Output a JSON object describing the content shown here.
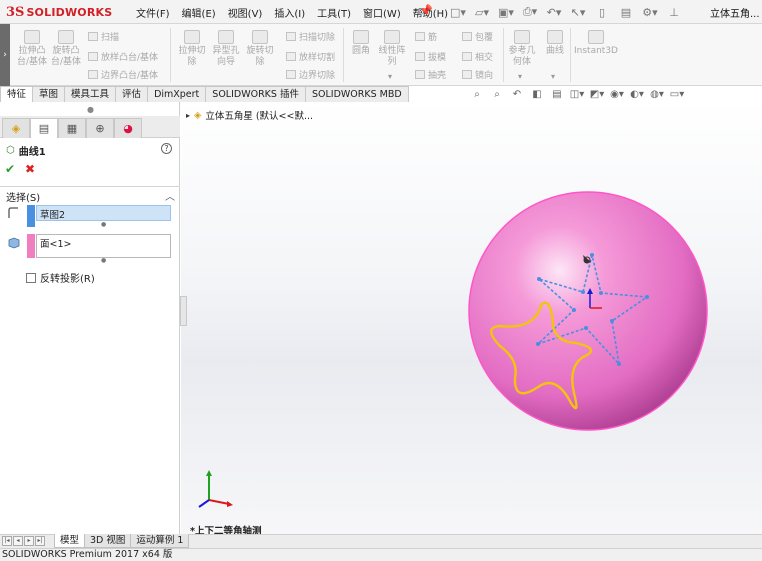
{
  "app": {
    "brand": "SOLIDWORKS",
    "document_title": "立体五角..."
  },
  "menu": [
    "文件(F)",
    "编辑(E)",
    "视图(V)",
    "插入(I)",
    "工具(T)",
    "窗口(W)",
    "帮助(H)"
  ],
  "ribbon": {
    "big_buttons": [
      {
        "label": "拉伸凸\n台/基体"
      },
      {
        "label": "旋转凸\n台/基体"
      },
      {
        "label": "拉伸切\n除"
      },
      {
        "label": "异型孔\n向导"
      },
      {
        "label": "旋转切\n除"
      },
      {
        "label": "圆角"
      },
      {
        "label": "线性阵\n列"
      },
      {
        "label": "参考几\n何体"
      },
      {
        "label": "曲线"
      },
      {
        "label": "Instant3D"
      }
    ],
    "small_buttons": [
      "扫描",
      "放样凸台/基体",
      "边界凸台/基体",
      "扫描切除",
      "放样切割",
      "边界切除",
      "筋",
      "拔模",
      "抽壳",
      "包覆",
      "相交",
      "镜向"
    ]
  },
  "command_tabs": [
    "特征",
    "草图",
    "模具工具",
    "评估",
    "DimXpert",
    "SOLIDWORKS 插件",
    "SOLIDWORKS MBD"
  ],
  "active_command_tab": "特征",
  "property_manager": {
    "title": "曲线1",
    "section_title": "选择(S)",
    "selection_sketch": "草图2",
    "selection_face": "面<1>",
    "reverse_projection_label": "反转投影(R)",
    "reverse_projection_checked": false
  },
  "tree": {
    "root_label": "立体五角星  (默认<<默..."
  },
  "viewport": {
    "view_name": "*上下二等角轴测"
  },
  "bottom_tabs": [
    "模型",
    "3D 视图",
    "运动算例 1"
  ],
  "active_bottom_tab": "模型",
  "status": "SOLIDWORKS Premium 2017 x64 版",
  "colors": {
    "sphere": "#e56fc4",
    "star_curve": "#f2c40d",
    "sketch_lines": "#4a8fe0",
    "sketch_highlight": "#cfe3f7",
    "sketch_color_tag": "#4a90e2",
    "face_color_tag": "#f07fc0"
  }
}
